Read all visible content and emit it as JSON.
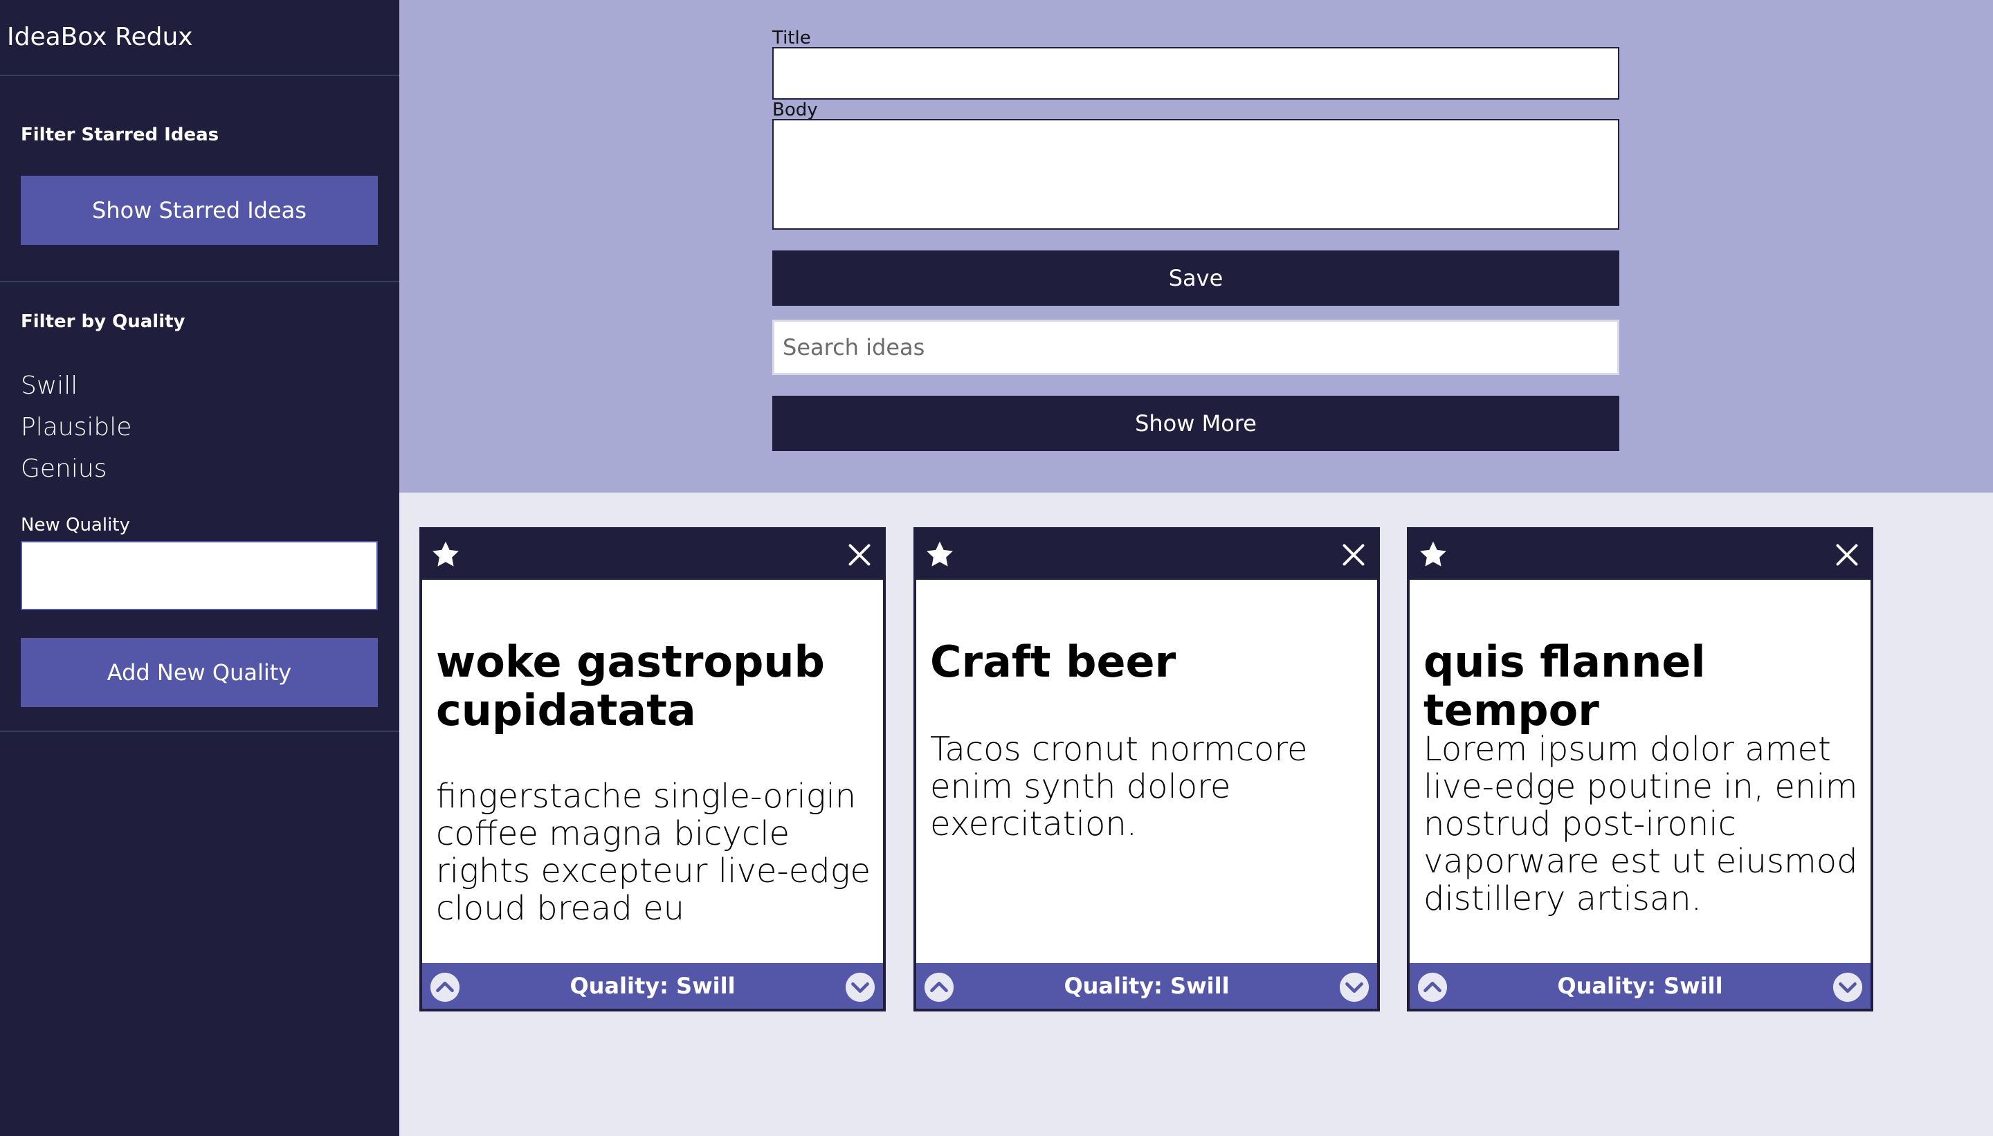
{
  "sidebar": {
    "app_title": "IdeaBox Redux",
    "filter_starred_label": "Filter Starred Ideas",
    "show_starred_button": "Show Starred Ideas",
    "filter_quality_label": "Filter by Quality",
    "qualities": [
      "Swill",
      "Plausible",
      "Genius"
    ],
    "new_quality_label": "New Quality",
    "new_quality_value": "",
    "add_quality_button": "Add New Quality"
  },
  "form": {
    "title_label": "Title",
    "title_value": "",
    "body_label": "Body",
    "body_value": "",
    "save_button": "Save",
    "search_placeholder": "Search ideas",
    "search_value": "",
    "show_more_button": "Show More"
  },
  "ideas": [
    {
      "title": "woke gastropub cupidatata",
      "body": "fingerstache single-origin coffee magna bicycle rights excepteur live-edge cloud bread eu",
      "quality": "Quality: Swill"
    },
    {
      "title": "Craft beer",
      "body": "Tacos cronut normcore enim synth dolore exercitation.",
      "quality": "Quality: Swill"
    },
    {
      "title": "quis flannel tempor",
      "body": "Lorem ipsum dolor amet live-edge poutine in, enim nostrud post-ironic vaporware est ut eiusmod distillery artisan.",
      "quality": "Quality: Swill"
    }
  ],
  "icons": {
    "star": "star-icon",
    "close": "close-icon",
    "upvote": "chevron-up-circle-icon",
    "downvote": "chevron-down-circle-icon"
  },
  "colors": {
    "sidebar_bg": "#1f1e3d",
    "accent": "#5457a8",
    "form_bg": "#a8aad3",
    "content_bg": "#e8e8f3"
  }
}
